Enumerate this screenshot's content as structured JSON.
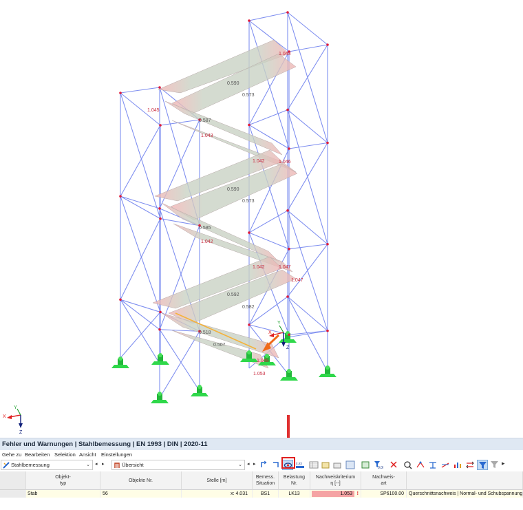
{
  "model": {
    "frame_labels": [
      "1.043",
      "1.045",
      "0.590",
      "0.573",
      "0.587",
      "1.043",
      "1.042",
      "1.046",
      "0.590",
      "0.573",
      "0.585",
      "1.042",
      "1.042",
      "1.047",
      "1.047",
      "0.592",
      "0.582",
      "0.518",
      "0.507",
      "1.049",
      "1.053"
    ],
    "axes": {
      "x": "X",
      "y": "Y",
      "z": "Z"
    },
    "global_axes": {
      "x": "X",
      "y": "Y",
      "z": "Z"
    }
  },
  "panel": {
    "title": "Fehler und Warnungen | Stahlbemessung | EN 1993 | DIN | 2020-11",
    "menu": [
      "Gehe zu",
      "Bearbeiten",
      "Selektion",
      "Ansicht",
      "Einstellungen"
    ],
    "module_select": "Stahlbemessung",
    "view_select": "Übersicht",
    "columns": [
      {
        "line1": "Objekt-",
        "line2": "typ"
      },
      {
        "line1": "Objekte Nr.",
        "line2": ""
      },
      {
        "line1": "Stelle [m]",
        "line2": ""
      },
      {
        "line1": "Bemess.",
        "line2": "Situation"
      },
      {
        "line1": "Belastung",
        "line2": "Nr."
      },
      {
        "line1": "Nachweiskriterium",
        "line2": "η [--]"
      },
      {
        "line1": "Nachweis-",
        "line2": "art"
      },
      {
        "line1": "",
        "line2": ""
      }
    ],
    "rows": [
      {
        "type": "Stab",
        "objects": "56",
        "location": "x: 4.031",
        "situation": "BS1",
        "load": "LK13",
        "eta": "1.053",
        "check_id": "SP6100.00",
        "check_desc": "Querschnittsnachweis | Normal- und Schubspannung"
      }
    ]
  },
  "colors": {
    "highlight_red": "#e02020",
    "eta_bad": "#f5a3a3",
    "row_bg": "#fffde6",
    "header_bg": "#dfe8f3"
  }
}
